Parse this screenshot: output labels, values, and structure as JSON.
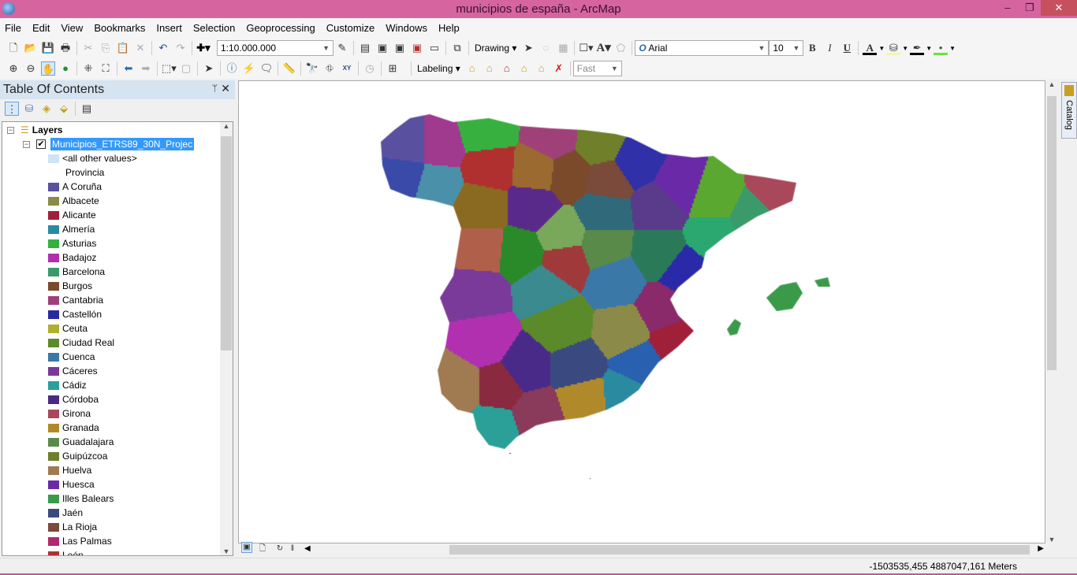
{
  "window": {
    "title": "municipios de españa - ArcMap",
    "minimize": "–",
    "restore": "❐",
    "close": "✕"
  },
  "menu": [
    "File",
    "Edit",
    "View",
    "Bookmarks",
    "Insert",
    "Selection",
    "Geoprocessing",
    "Customize",
    "Windows",
    "Help"
  ],
  "toolbar": {
    "scale": "1:10.000.000",
    "drawing_label": "Drawing",
    "font": "Arial",
    "font_size": "10",
    "bold": "B",
    "italic": "I",
    "underline": "U",
    "labeling_label": "Labeling",
    "label_quality": "Fast"
  },
  "toc": {
    "title": "Table Of Contents",
    "pin": "ㅁ",
    "close": "✕",
    "root": "Layers",
    "layer": "Municipios_ETRS89_30N_Projec",
    "layer_checked": true,
    "other_values": "<all other values>",
    "other_color": "#cfe3f5",
    "field": "Provincia",
    "classes": [
      {
        "label": "A Coruña",
        "color": "#5a50a0"
      },
      {
        "label": "Albacete",
        "color": "#8c8a48"
      },
      {
        "label": "Alicante",
        "color": "#a0203a"
      },
      {
        "label": "Almería",
        "color": "#2a8aa0"
      },
      {
        "label": "Asturias",
        "color": "#38b040"
      },
      {
        "label": "Badajoz",
        "color": "#b030b0"
      },
      {
        "label": "Barcelona",
        "color": "#3a9a6a"
      },
      {
        "label": "Burgos",
        "color": "#7a4a2a"
      },
      {
        "label": "Cantabria",
        "color": "#a04078"
      },
      {
        "label": "Castellón",
        "color": "#2a2aa0"
      },
      {
        "label": "Ceuta",
        "color": "#b0b030"
      },
      {
        "label": "Ciudad Real",
        "color": "#5a8a2a"
      },
      {
        "label": "Cuenca",
        "color": "#3a78a8"
      },
      {
        "label": "Cáceres",
        "color": "#7a3a9a"
      },
      {
        "label": "Cádiz",
        "color": "#2aa098"
      },
      {
        "label": "Córdoba",
        "color": "#4a2a88"
      },
      {
        "label": "Girona",
        "color": "#a8485a"
      },
      {
        "label": "Granada",
        "color": "#b08a2a"
      },
      {
        "label": "Guadalajara",
        "color": "#5a8a4a"
      },
      {
        "label": "Guipúzcoa",
        "color": "#6f7f2a"
      },
      {
        "label": "Huelva",
        "color": "#a07a50"
      },
      {
        "label": "Huesca",
        "color": "#6a2aa8"
      },
      {
        "label": "Illes Balears",
        "color": "#3a9a4a"
      },
      {
        "label": "Jaén",
        "color": "#3a4a80"
      },
      {
        "label": "La Rioja",
        "color": "#7a4a3a"
      },
      {
        "label": "Las Palmas",
        "color": "#b02a6a"
      },
      {
        "label": "León",
        "color": "#b03030"
      }
    ]
  },
  "catalog_tab": "Catalog",
  "status": {
    "coordinates": "-1503535,455  4887047,161 Meters"
  }
}
